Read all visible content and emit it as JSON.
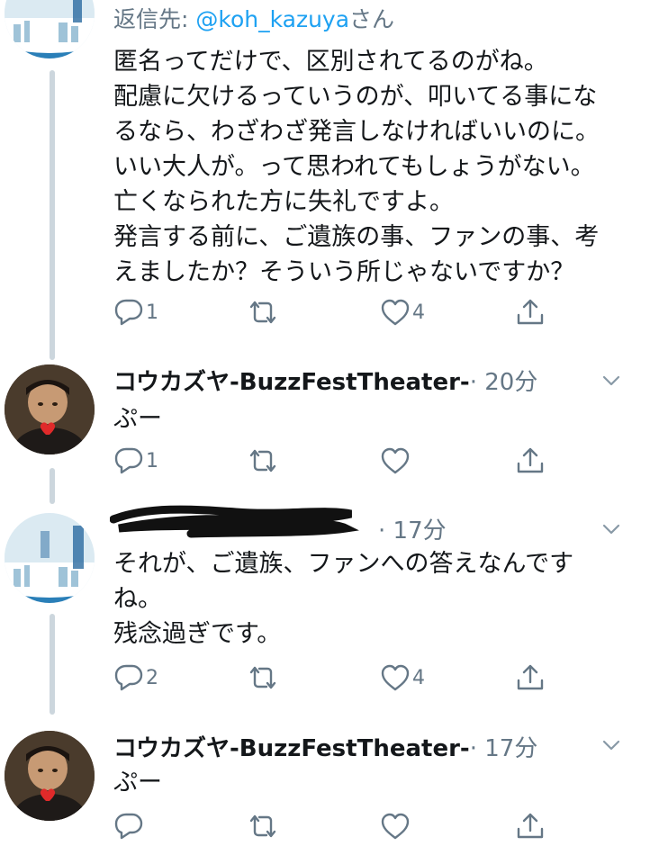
{
  "tweets": [
    {
      "reply_prefix": "返信先: ",
      "reply_handle": "@koh_kazuya",
      "reply_suffix": "さん",
      "lines": [
        "匿名ってだけで、区別されてるのがね。",
        "配慮に欠けるっていうのが、叩いてる事にな",
        "るなら、わざわざ発言しなければいいのに。",
        "いい大人が。って思われてもしょうがない。",
        "亡くなられた方に失礼ですよ。",
        "発言する前に、ご遺族の事、ファンの事、考",
        "えましたか？そういう所じゃないですか？"
      ],
      "reply_count": "1",
      "retweet_count": "",
      "like_count": "4"
    },
    {
      "name": "コウカズヤ-BuzzFestTheater-",
      "meta": "· 20分",
      "lines": [
        "ぷー"
      ],
      "reply_count": "1",
      "retweet_count": "",
      "like_count": ""
    },
    {
      "meta": "· 17分",
      "lines": [
        "それが、ご遺族、ファンへの答えなんです",
        "ね。",
        "残念過ぎです。"
      ],
      "reply_count": "2",
      "retweet_count": "",
      "like_count": "4"
    },
    {
      "name": "コウカズヤ-BuzzFestTheater-",
      "meta": "· 17分",
      "lines": [
        "ぷー"
      ],
      "reply_count": "",
      "retweet_count": "",
      "like_count": ""
    }
  ],
  "icons": {
    "reply": "reply-icon",
    "retweet": "retweet-icon",
    "like": "heart-icon",
    "share": "share-icon",
    "more": "chevron-down-icon"
  },
  "colors": {
    "link": "#1da1f2",
    "secondary": "#657786",
    "thread_line": "#ccd6dd",
    "text": "#14171a"
  }
}
